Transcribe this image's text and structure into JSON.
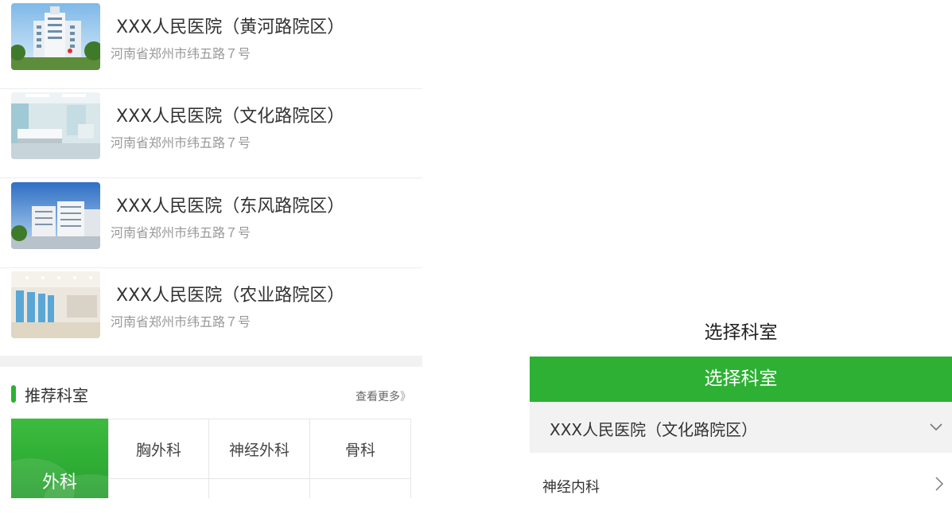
{
  "hospitals": [
    {
      "name": "XXX人民医院（黄河路院区）",
      "address": "河南省郑州市纬五路７号",
      "thumb_icon": "hospital-building-photo"
    },
    {
      "name": "XXX人民医院（文化路院区）",
      "address": "河南省郑州市纬五路７号",
      "thumb_icon": "ward-room-photo"
    },
    {
      "name": "XXX人民医院（东风路院区）",
      "address": "河南省郑州市纬五路７号",
      "thumb_icon": "hospital-exterior-photo"
    },
    {
      "name": "XXX人民医院（农业路院区）",
      "address": "河南省郑州市纬五路７号",
      "thumb_icon": "hospital-hall-photo"
    }
  ],
  "recommended": {
    "title": "推荐科室",
    "more_label": "查看更多",
    "more_arrow": "》",
    "feature": "外科",
    "departments": [
      "胸外科",
      "神经外科",
      "骨科"
    ]
  },
  "select_panel": {
    "title": "选择科室",
    "header_label": "选择科室",
    "hospital_selected": "XXX人民医院（文化路院区）",
    "first_department": "神经内科"
  },
  "colors": {
    "accent": "#2db033",
    "band": "#f2f2f2"
  }
}
